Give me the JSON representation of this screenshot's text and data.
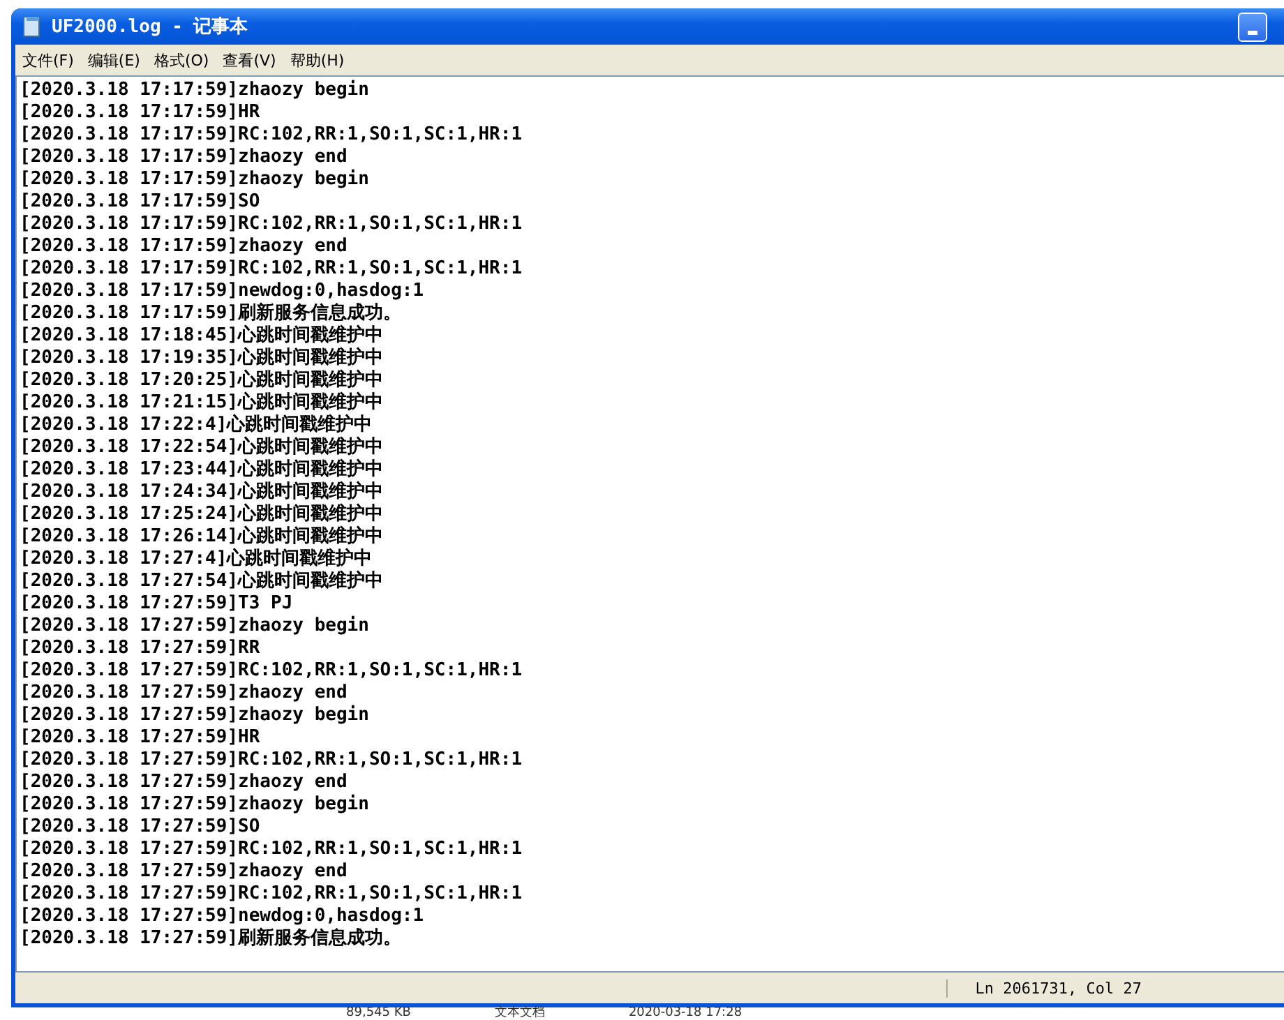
{
  "window": {
    "title": "UF2000.log - 记事本"
  },
  "menu": [
    "文件(F)",
    "编辑(E)",
    "格式(O)",
    "查看(V)",
    "帮助(H)"
  ],
  "lines": [
    "[2020.3.18 17:17:59]zhaozy begin",
    "[2020.3.18 17:17:59]HR",
    "[2020.3.18 17:17:59]RC:102,RR:1,SO:1,SC:1,HR:1",
    "[2020.3.18 17:17:59]zhaozy end",
    "[2020.3.18 17:17:59]zhaozy begin",
    "[2020.3.18 17:17:59]SO",
    "[2020.3.18 17:17:59]RC:102,RR:1,SO:1,SC:1,HR:1",
    "[2020.3.18 17:17:59]zhaozy end",
    "[2020.3.18 17:17:59]RC:102,RR:1,SO:1,SC:1,HR:1",
    "[2020.3.18 17:17:59]newdog:0,hasdog:1",
    "[2020.3.18 17:17:59]刷新服务信息成功。",
    "[2020.3.18 17:18:45]心跳时间戳维护中",
    "[2020.3.18 17:19:35]心跳时间戳维护中",
    "[2020.3.18 17:20:25]心跳时间戳维护中",
    "[2020.3.18 17:21:15]心跳时间戳维护中",
    "[2020.3.18 17:22:4]心跳时间戳维护中",
    "[2020.3.18 17:22:54]心跳时间戳维护中",
    "[2020.3.18 17:23:44]心跳时间戳维护中",
    "[2020.3.18 17:24:34]心跳时间戳维护中",
    "[2020.3.18 17:25:24]心跳时间戳维护中",
    "[2020.3.18 17:26:14]心跳时间戳维护中",
    "[2020.3.18 17:27:4]心跳时间戳维护中",
    "[2020.3.18 17:27:54]心跳时间戳维护中",
    "[2020.3.18 17:27:59]T3 PJ",
    "[2020.3.18 17:27:59]zhaozy begin",
    "[2020.3.18 17:27:59]RR",
    "[2020.3.18 17:27:59]RC:102,RR:1,SO:1,SC:1,HR:1",
    "[2020.3.18 17:27:59]zhaozy end",
    "[2020.3.18 17:27:59]zhaozy begin",
    "[2020.3.18 17:27:59]HR",
    "[2020.3.18 17:27:59]RC:102,RR:1,SO:1,SC:1,HR:1",
    "[2020.3.18 17:27:59]zhaozy end",
    "[2020.3.18 17:27:59]zhaozy begin",
    "[2020.3.18 17:27:59]SO",
    "[2020.3.18 17:27:59]RC:102,RR:1,SO:1,SC:1,HR:1",
    "[2020.3.18 17:27:59]zhaozy end",
    "[2020.3.18 17:27:59]RC:102,RR:1,SO:1,SC:1,HR:1",
    "[2020.3.18 17:27:59]newdog:0,hasdog:1",
    "[2020.3.18 17:27:59]刷新服务信息成功。"
  ],
  "status_bar": {
    "position": "Ln 2061731, Col 27"
  },
  "background_file_row": [
    "89,545 KB",
    "文本文档",
    "2020-03-18 17:28"
  ]
}
